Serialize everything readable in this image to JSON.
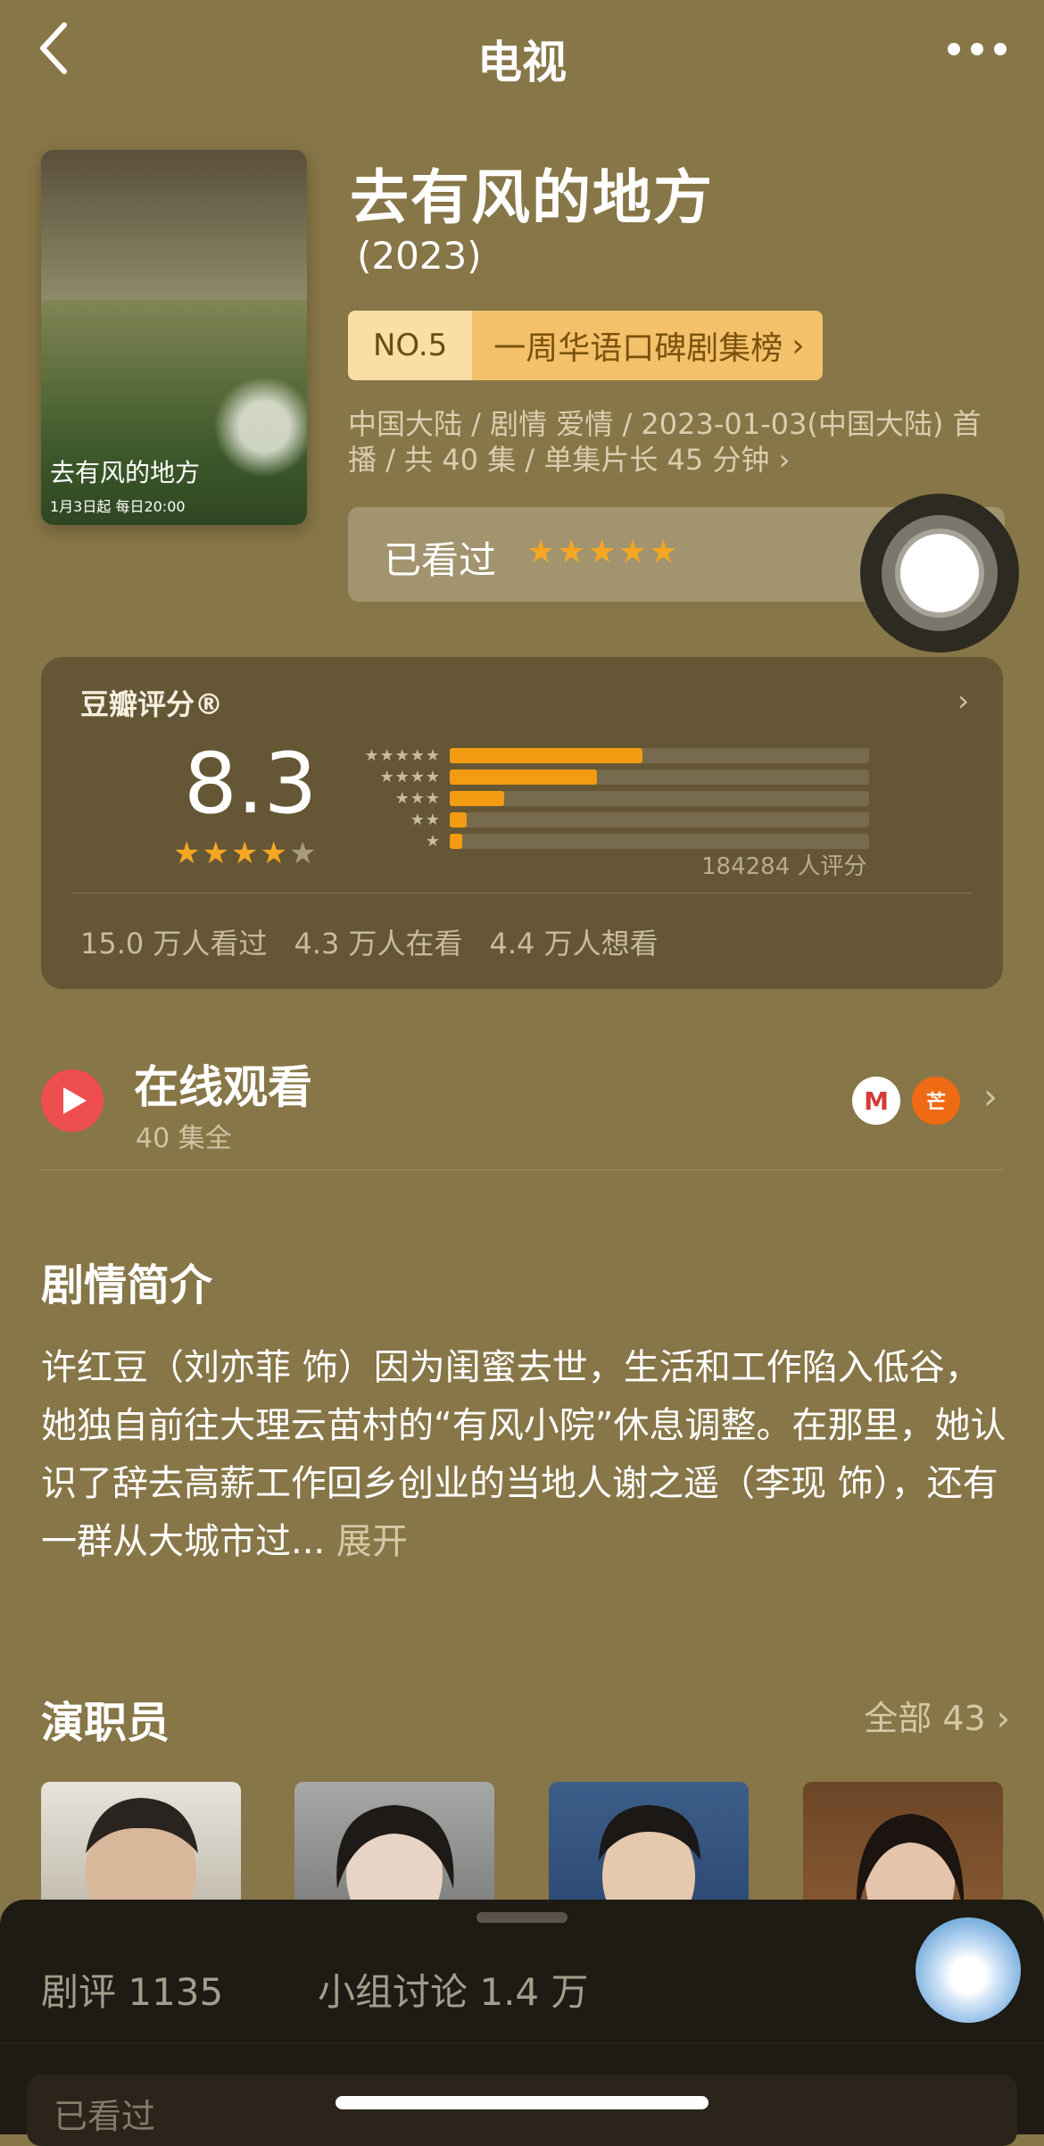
{
  "nav": {
    "title": "电视"
  },
  "show": {
    "title": "去有风的地方",
    "year": "(2023)",
    "rank_no": "NO.5",
    "rank_text": "一周华语口碑剧集榜",
    "meta_line1": "中国大陆 / 剧情 爱情 / 2023-01-03(中国大陆) 首",
    "meta_line2": "播 / 共 40 集 / 单集片长 45 分钟",
    "poster_caption": "去有风的地方",
    "poster_sub": "1月3日起 每日20:00"
  },
  "watched": {
    "label": "已看过",
    "stars": "★★★★★",
    "my_rating": 5
  },
  "rating": {
    "title": "豆瓣评分®",
    "score": "8.3",
    "stars_filled": 4,
    "distribution": [
      {
        "stars": "★★★★★",
        "fraction": 0.46
      },
      {
        "stars": "★★★★",
        "fraction": 0.35
      },
      {
        "stars": "★★★",
        "fraction": 0.13
      },
      {
        "stars": "★★",
        "fraction": 0.04
      },
      {
        "stars": "★",
        "fraction": 0.03
      }
    ],
    "count": "184284 人评分",
    "stats": [
      "15.0 万人看过",
      "4.3 万人在看",
      "4.4 万人想看"
    ]
  },
  "online": {
    "title": "在线观看",
    "sub": "40 集全",
    "logo1": "M",
    "logo2": "芒"
  },
  "synopsis": {
    "title": "剧情简介",
    "text": "许红豆（刘亦菲 饰）因为闺蜜去世，生活和工作陷入低谷，她独自前往大理云苗村的“有风小院”休息调整。在那里，她认识了辞去高薪工作回乡创业的当地人谢之遥（李现 饰），还有一群从大城市过...",
    "expand": " 展开"
  },
  "cast": {
    "title": "演职员",
    "all": "全部 43 ›"
  },
  "sheet": {
    "tab1": "剧评 1135",
    "tab2": "小组讨论 1.4 万",
    "peek": "已看过"
  },
  "colors": {
    "background": "#877647",
    "accent": "#f5a623",
    "bar": "#f39c12",
    "play": "#ef4e4e"
  }
}
